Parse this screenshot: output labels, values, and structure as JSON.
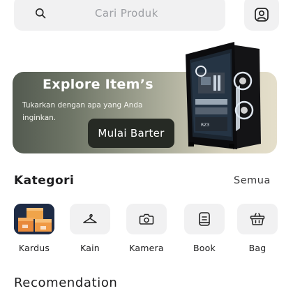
{
  "search": {
    "placeholder": "Cari Produk",
    "icon": "search-icon"
  },
  "profile": {
    "icon": "user-icon"
  },
  "banner": {
    "title": "Explore Item’s",
    "subtitle": "Tukarkan dengan apa yang Anda inginkan.",
    "button_label": "Mulai Barter",
    "product_badge": "RZ3"
  },
  "categories": {
    "title": "Kategori",
    "see_all": "Semua",
    "items": [
      {
        "label": "Kardus",
        "icon": "box-image"
      },
      {
        "label": "Kain",
        "icon": "hanger-icon"
      },
      {
        "label": "Kamera",
        "icon": "camera-icon"
      },
      {
        "label": "Book",
        "icon": "book-icon"
      },
      {
        "label": "Bag",
        "icon": "basket-icon"
      }
    ]
  },
  "recommendation": {
    "title": "Recomendation"
  },
  "colors": {
    "chip_bg": "#f1f1f2",
    "button_dark": "#262a24",
    "banner_start": "#535a50",
    "banner_end": "#e5dfcb"
  }
}
